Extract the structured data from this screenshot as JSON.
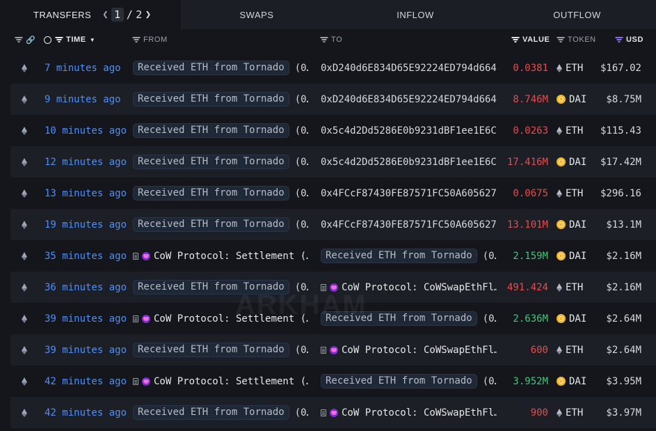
{
  "tabs": {
    "transfers": "TRANSFERS",
    "pager": {
      "current": "1",
      "separator": "/",
      "total": "2"
    },
    "swaps": "SWAPS",
    "inflow": "INFLOW",
    "outflow": "OUTFLOW"
  },
  "columns": {
    "time": "TIME",
    "from": "FROM",
    "to": "TO",
    "value": "VALUE",
    "token": "TOKEN",
    "usd": "USD"
  },
  "watermark": "ARKHAM",
  "colors": {
    "time_link": "#4f8ff7",
    "negative": "#e84c4f",
    "positive": "#46c57b",
    "usd_filter": "#8b6cf2"
  },
  "rows": [
    {
      "time": "7 minutes ago",
      "from": "Received ETH from Tornado",
      "from_suffix": "(0…",
      "to": "0xD240d6E834D65E92224ED794d664…",
      "value": "0.0381",
      "token": "ETH",
      "usd": "$167.02"
    },
    {
      "time": "9 minutes ago",
      "from": "Received ETH from Tornado",
      "from_suffix": "(0…",
      "to": "0xD240d6E834D65E92224ED794d664…",
      "value": "8.746M",
      "token": "DAI",
      "usd": "$8.75M"
    },
    {
      "time": "10 minutes ago",
      "from": "Received ETH from Tornado",
      "from_suffix": "(0…",
      "to": "0x5c4d2Dd5286E0b9231dBF1ee1E6C…",
      "value": "0.0263",
      "token": "ETH",
      "usd": "$115.43"
    },
    {
      "time": "12 minutes ago",
      "from": "Received ETH from Tornado",
      "from_suffix": "(0…",
      "to": "0x5c4d2Dd5286E0b9231dBF1ee1E6C…",
      "value": "17.416M",
      "token": "DAI",
      "usd": "$17.42M"
    },
    {
      "time": "13 minutes ago",
      "from": "Received ETH from Tornado",
      "from_suffix": "(0…",
      "to": "0x4FCcF87430FE87571FC50A605627…",
      "value": "0.0675",
      "token": "ETH",
      "usd": "$296.16"
    },
    {
      "time": "19 minutes ago",
      "from": "Received ETH from Tornado",
      "from_suffix": "(0…",
      "to": "0x4FCcF87430FE87571FC50A605627…",
      "value": "13.101M",
      "token": "DAI",
      "usd": "$13.1M"
    },
    {
      "time": "35 minutes ago",
      "from": "CoW Protocol: Settlement (…",
      "to": "Received ETH from Tornado",
      "to_suffix": "(0…",
      "value": "2.159M",
      "token": "DAI",
      "usd": "$2.16M"
    },
    {
      "time": "36 minutes ago",
      "from": "Received ETH from Tornado",
      "from_suffix": "(0…",
      "to": "CoW Protocol: CoWSwapEthFl…",
      "value": "491.424",
      "token": "ETH",
      "usd": "$2.16M"
    },
    {
      "time": "39 minutes ago",
      "from": "CoW Protocol: Settlement (…",
      "to": "Received ETH from Tornado",
      "to_suffix": "(0…",
      "value": "2.636M",
      "token": "DAI",
      "usd": "$2.64M"
    },
    {
      "time": "39 minutes ago",
      "from": "Received ETH from Tornado",
      "from_suffix": "(0…",
      "to": "CoW Protocol: CoWSwapEthFl…",
      "value": "600",
      "token": "ETH",
      "usd": "$2.64M"
    },
    {
      "time": "42 minutes ago",
      "from": "CoW Protocol: Settlement (…",
      "to": "Received ETH from Tornado",
      "to_suffix": "(0…",
      "value": "3.952M",
      "token": "DAI",
      "usd": "$3.95M"
    },
    {
      "time": "42 minutes ago",
      "from": "Received ETH from Tornado",
      "from_suffix": "(0…",
      "to": "CoW Protocol: CoWSwapEthFl…",
      "value": "900",
      "token": "ETH",
      "usd": "$3.97M"
    }
  ]
}
